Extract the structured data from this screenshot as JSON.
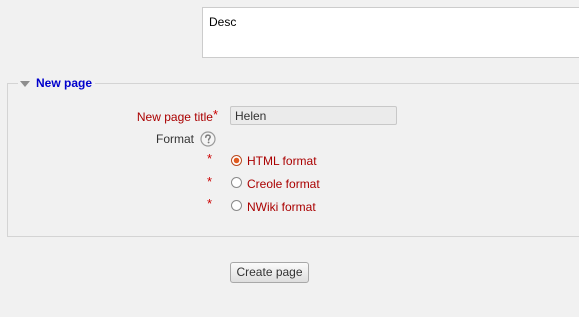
{
  "description": {
    "value": "Desc"
  },
  "section": {
    "legend": "New page"
  },
  "page_title": {
    "label": "New page title",
    "required_mark": "*",
    "value": "Helen"
  },
  "format": {
    "label": "Format",
    "help_icon": "question-circle-icon",
    "options": [
      {
        "label": "HTML format",
        "required_mark": "*",
        "checked": true
      },
      {
        "label": "Creole format",
        "required_mark": "*",
        "checked": false
      },
      {
        "label": "NWiki format",
        "required_mark": "*",
        "checked": false
      }
    ]
  },
  "actions": {
    "create_label": "Create page"
  },
  "colors": {
    "background": "#f1f1f1",
    "legend_link": "#0000cc",
    "label_red": "#aa0000",
    "required_red": "#cc0000",
    "radio_selected": "#e05a1e"
  }
}
